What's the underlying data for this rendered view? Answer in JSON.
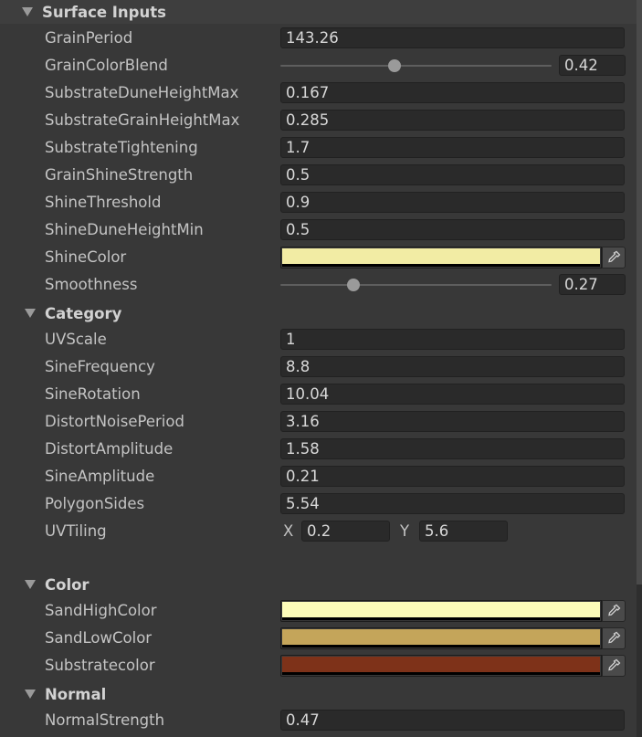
{
  "sections": {
    "surface_inputs": "Surface Inputs",
    "category": "Category",
    "color": "Color",
    "normal": "Normal"
  },
  "surface": {
    "grain_period": {
      "label": "GrainPeriod",
      "value": "143.26"
    },
    "grain_color_blend": {
      "label": "GrainColorBlend",
      "value": "0.42",
      "level": 0.42
    },
    "substrate_dune_height_max": {
      "label": "SubstrateDuneHeightMax",
      "value": "0.167"
    },
    "substrate_grain_height_max": {
      "label": "SubstrateGrainHeightMax",
      "value": "0.285"
    },
    "substrate_tightening": {
      "label": "SubstrateTightening",
      "value": "1.7"
    },
    "grain_shine_strength": {
      "label": "GrainShineStrength",
      "value": "0.5"
    },
    "shine_threshold": {
      "label": "ShineThreshold",
      "value": "0.9"
    },
    "shine_dune_height_min": {
      "label": "ShineDuneHeightMin",
      "value": "0.5"
    },
    "shine_color": {
      "label": "ShineColor",
      "color": "#f2eca4"
    },
    "smoothness": {
      "label": "Smoothness",
      "value": "0.27",
      "level": 0.27
    }
  },
  "category": {
    "uv_scale": {
      "label": "UVScale",
      "value": "1"
    },
    "sine_frequency": {
      "label": "SineFrequency",
      "value": "8.8"
    },
    "sine_rotation": {
      "label": "SineRotation",
      "value": "10.04"
    },
    "distort_noise_period": {
      "label": "DistortNoisePeriod",
      "value": "3.16"
    },
    "distort_amplitude": {
      "label": "DistortAmplitude",
      "value": "1.58"
    },
    "sine_amplitude": {
      "label": "SineAmplitude",
      "value": "0.21"
    },
    "polygon_sides": {
      "label": "PolygonSides",
      "value": "5.54"
    },
    "uv_tiling": {
      "label": "UVTiling",
      "x_label": "X",
      "x": "0.2",
      "y_label": "Y",
      "y": "5.6"
    }
  },
  "color": {
    "sand_high_color": {
      "label": "SandHighColor",
      "color": "#fcfcb8"
    },
    "sand_low_color": {
      "label": "SandLowColor",
      "color": "#c4a55a"
    },
    "substrate_color": {
      "label": "Substratecolor",
      "color": "#7e3219"
    }
  },
  "normal": {
    "normal_strength": {
      "label": "NormalStrength",
      "value": "0.47"
    }
  },
  "icons": {
    "picker": "eyedropper-icon",
    "foldout": "triangle-down-icon"
  }
}
